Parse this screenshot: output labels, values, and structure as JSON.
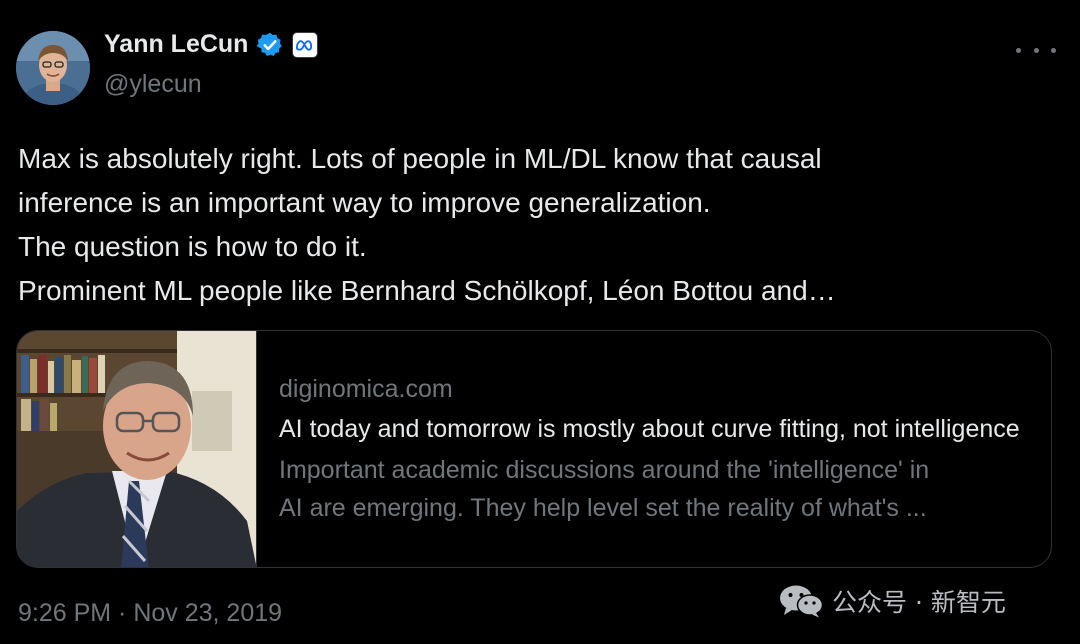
{
  "author": {
    "name": "Yann LeCun",
    "handle": "@ylecun",
    "verified_color": "#1d9bf0",
    "affiliation_icon": "meta-logo"
  },
  "tweet": {
    "lines": [
      "Max is absolutely right. Lots of people in ML/DL know that causal",
      "inference is an important way to improve generalization.",
      "The question is how to do it.",
      "Prominent ML people like Bernhard Schölkopf, Léon Bottou and…"
    ],
    "timestamp": "9:26 PM · Nov 23, 2019"
  },
  "link_card": {
    "domain": "diginomica.com",
    "title": "AI today and tomorrow is mostly about curve fitting, not intelligence",
    "description_lines": [
      "Important academic discussions around the 'intelligence' in",
      "AI are emerging. They help level set the reality of what's ..."
    ]
  },
  "watermark": {
    "text": "公众号 · 新智元",
    "icon": "wechat-icon"
  },
  "colors": {
    "background": "#000000",
    "primary_text": "#e7e9ea",
    "secondary_text": "#71767b",
    "border": "#2f3336"
  }
}
